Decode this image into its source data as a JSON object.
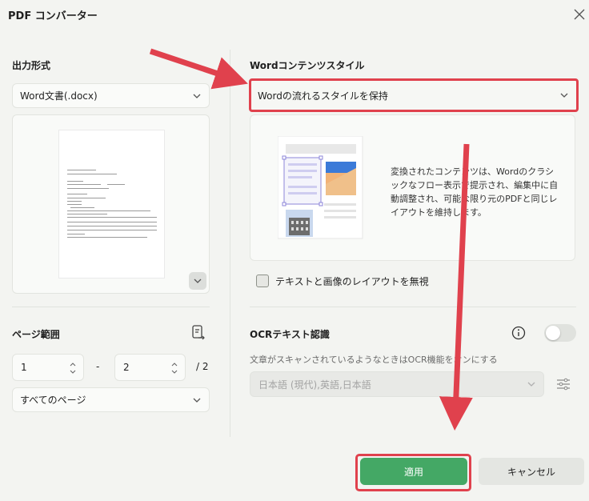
{
  "dialog": {
    "title": "PDF コンバーター"
  },
  "output_format": {
    "label": "出力形式",
    "selected": "Word文書(.docx)"
  },
  "page_range": {
    "label": "ページ範囲",
    "from": "1",
    "separator": "-",
    "to": "2",
    "total": "/ 2",
    "scope_selected": "すべてのページ"
  },
  "word_style": {
    "label": "Wordコンテンツスタイル",
    "selected": "Wordの流れるスタイルを保持",
    "description": "変換されたコンテンツは、Wordのクラシックなフロー表示で提示され、編集中に自動調整され、可能な限り元のPDFと同じレイアウトを維持します。"
  },
  "ignore_layout": {
    "label": "テキストと画像のレイアウトを無視",
    "checked": false
  },
  "ocr": {
    "label": "OCRテキスト認識",
    "hint": "文章がスキャンされているようなときはOCR機能をオンにする",
    "language": "日本語 (現代),英語,日本語",
    "enabled": false
  },
  "buttons": {
    "apply": "適用",
    "cancel": "キャンセル"
  },
  "colors": {
    "accent_green": "#44a865",
    "highlight_red": "#e0414d"
  },
  "icons": [
    "close-icon",
    "chevron-down-icon",
    "page-range-icon",
    "info-icon",
    "settings-sliders-icon",
    "expand-icon"
  ]
}
